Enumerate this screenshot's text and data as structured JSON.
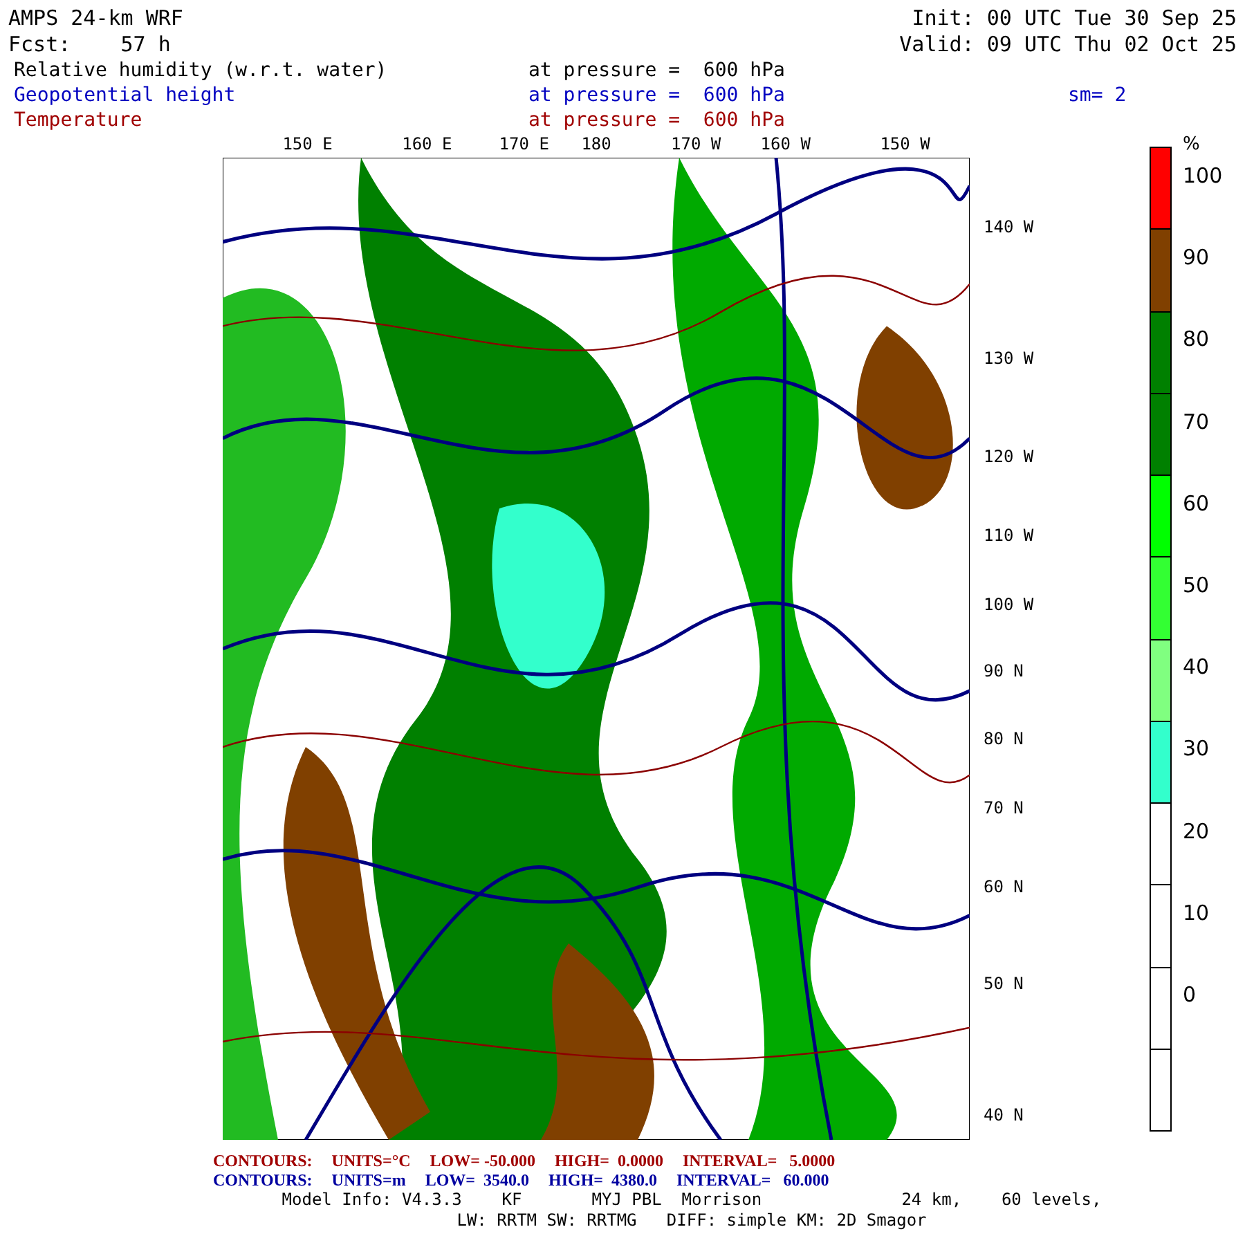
{
  "header": {
    "model": "AMPS 24-km WRF",
    "init": "Init: 00 UTC Tue 30 Sep 25",
    "forecast": "Fcst:    57 h",
    "valid": "Valid: 09 UTC Thu 02 Oct 25"
  },
  "fields": [
    {
      "name": "Relative humidity (w.r.t. water)",
      "level": "at pressure =  600 hPa",
      "color": "#000000"
    },
    {
      "name": "Geopotential height",
      "level": "at pressure =  600 hPa",
      "extra": "sm= 2",
      "color": "#0000c0"
    },
    {
      "name": "Temperature",
      "level": "at pressure =  600 hPa",
      "color": "#a00000"
    }
  ],
  "top_axis_labels": [
    "150 E",
    "160 E",
    "170 E",
    "180",
    "170 W",
    "160 W",
    "150 W"
  ],
  "right_axis_labels": [
    "140 W",
    "130 W",
    "120 W",
    "110 W",
    "100 W",
    "90 N",
    "80 N",
    "70 N",
    "60 N",
    "50 N",
    "40 N"
  ],
  "colorbar": {
    "unit": "%",
    "segments": [
      {
        "color": "#ff0000"
      },
      {
        "color": "#804000"
      },
      {
        "color": "#008000"
      },
      {
        "color": "#008000"
      },
      {
        "color": "#00ff00"
      },
      {
        "color": "#33ff33"
      },
      {
        "color": "#80ff80"
      },
      {
        "color": "#33ffcc"
      },
      {
        "color": "#ffffff"
      },
      {
        "color": "#ffffff"
      },
      {
        "color": "#ffffff"
      },
      {
        "color": "#ffffff"
      }
    ],
    "labels": [
      "100",
      "90",
      "80",
      "70",
      "60",
      "50",
      "40",
      "30",
      "20",
      "10",
      "0"
    ]
  },
  "contour_info": [
    {
      "color": "#a00000",
      "label": "CONTOURS:",
      "units": "UNITS=°C",
      "low": "LOW= -50.000",
      "high": "HIGH=  0.0000",
      "interval": "INTERVAL=   5.0000"
    },
    {
      "color": "#0000a0",
      "label": "CONTOURS:",
      "units": "UNITS=m",
      "low": "LOW=  3540.0",
      "high": "HIGH=  4380.0",
      "interval": "INTERVAL=   60.000"
    }
  ],
  "model_info": [
    "Model Info: V4.3.3    KF       MYJ PBL  Morrison              24 km,    60 levels,",
    "LW: RRTM SW: RRTMG   DIFF: simple KM: 2D Smagor"
  ]
}
